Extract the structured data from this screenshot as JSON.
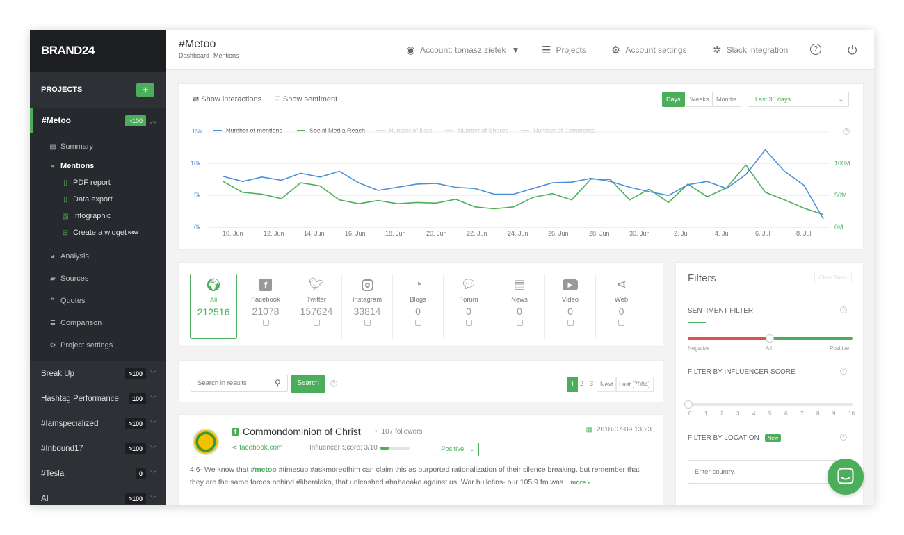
{
  "app": {
    "logo": "BRAND24"
  },
  "sidebar": {
    "projects_label": "PROJECTS",
    "add_label": "+",
    "active_project": {
      "name": "#Metoo",
      "badge": ">100"
    },
    "sub_items": [
      {
        "label": "Summary",
        "icon": "document-icon"
      },
      {
        "label": "Mentions",
        "icon": "chat-icon"
      },
      {
        "label": "PDF report",
        "icon": "pdf-icon"
      },
      {
        "label": "Data export",
        "icon": "export-icon"
      },
      {
        "label": "Infographic",
        "icon": "image-icon"
      },
      {
        "label": "Create a widget",
        "sup": "New",
        "icon": "widget-icon"
      },
      {
        "label": "Analysis",
        "icon": "pie-icon"
      },
      {
        "label": "Sources",
        "icon": "briefcase-icon"
      },
      {
        "label": "Quotes",
        "icon": "quote-icon"
      },
      {
        "label": "Comparison",
        "icon": "list-icon"
      },
      {
        "label": "Project settings",
        "icon": "cogs-icon"
      }
    ],
    "projects": [
      {
        "name": "Break Up",
        "badge": ">100"
      },
      {
        "name": "Hashtag Performance",
        "badge": "100"
      },
      {
        "name": "#Iamspecialized",
        "badge": ">100"
      },
      {
        "name": "#Inbound17",
        "badge": ">100"
      },
      {
        "name": "#Tesla",
        "badge": "0"
      },
      {
        "name": "AI",
        "badge": ">100"
      }
    ]
  },
  "header": {
    "title": "#Metoo",
    "breadcrumb": [
      "Dashboard",
      "Mentions"
    ],
    "account": "Account: tomasz.zietek",
    "projects": "Projects",
    "settings": "Account settings",
    "slack": "Slack integration",
    "help": "?",
    "power": "⏻"
  },
  "chart_card": {
    "show_interactions": "Show interactions",
    "show_sentiment": "Show sentiment",
    "granularity": [
      "Days",
      "Weeks",
      "Months"
    ],
    "range": "Last 30 days",
    "help": "?"
  },
  "chart_data": {
    "type": "line",
    "x": [
      "10. Jun",
      "12. Jun",
      "14. Jun",
      "16. Jun",
      "18. Jun",
      "20. Jun",
      "22. Jun",
      "24. Jun",
      "26. Jun",
      "28. Jun",
      "30. Jun",
      "2. Jul",
      "4. Jul",
      "6. Jul",
      "8. Jul"
    ],
    "left_ticks": [
      "15k",
      "10k",
      "5k",
      "0k"
    ],
    "right_ticks": [
      "100M",
      "50M",
      "0M"
    ],
    "ylim_left": [
      0,
      15000
    ],
    "ylim_right": [
      0,
      150000000
    ],
    "series": [
      {
        "name": "Number of mentions",
        "color": "#4a90d9",
        "axis": "left",
        "values": [
          8000,
          7200,
          7900,
          7400,
          8500,
          7900,
          8800,
          7000,
          5800,
          6300,
          6800,
          6900,
          6300,
          6100,
          5200,
          5200,
          6100,
          7000,
          7100,
          7700,
          7200,
          6300,
          5600,
          5000,
          6700,
          7200,
          6100,
          8300,
          12200,
          8800,
          6600,
          1300
        ]
      },
      {
        "name": "Social Media Reach",
        "color": "#4cae5b",
        "axis": "right",
        "values": [
          72000000,
          55000000,
          52000000,
          45000000,
          70000000,
          65000000,
          43000000,
          37000000,
          42000000,
          37000000,
          39000000,
          38000000,
          44000000,
          32000000,
          29000000,
          32000000,
          47000000,
          53000000,
          43000000,
          76000000,
          75000000,
          43000000,
          60000000,
          39000000,
          68000000,
          48000000,
          62000000,
          98000000,
          55000000,
          43000000,
          30000000,
          20000000
        ]
      },
      {
        "name": "Number of likes",
        "color": "#cccccc",
        "axis": "left",
        "values": []
      },
      {
        "name": "Number of Shares",
        "color": "#cccccc",
        "axis": "left",
        "values": []
      },
      {
        "name": "Number of Comments",
        "color": "#cccccc",
        "axis": "left",
        "values": []
      }
    ],
    "legend_position": "top-left"
  },
  "channels": [
    {
      "name": "All",
      "count": "212516",
      "icon": "globe-icon"
    },
    {
      "name": "Facebook",
      "count": "21078",
      "icon": "facebook-icon"
    },
    {
      "name": "Twitter",
      "count": "157624",
      "icon": "twitter-icon"
    },
    {
      "name": "Instagram",
      "count": "33814",
      "icon": "instagram-icon"
    },
    {
      "name": "Blogs",
      "count": "0",
      "icon": "rss-icon"
    },
    {
      "name": "Forum",
      "count": "0",
      "icon": "forum-icon"
    },
    {
      "name": "News",
      "count": "0",
      "icon": "news-icon"
    },
    {
      "name": "Video",
      "count": "0",
      "icon": "video-icon"
    },
    {
      "name": "Web",
      "count": "0",
      "icon": "share-icon"
    }
  ],
  "search": {
    "placeholder": "Search in results",
    "button": "Search",
    "help": "?",
    "pages": [
      "1",
      "2",
      "3"
    ],
    "next": "Next",
    "last": "Last [7084]"
  },
  "mention": {
    "author": "Commondominion of Christ",
    "followers": "107 followers",
    "date": "2018-07-09 13:23",
    "source": "facebook.com",
    "influencer": "Influencer Score: 3/10",
    "influencer_score": 0.3,
    "sentiment": "Positive",
    "text_before": "4:6- We know that ",
    "keyword": "#metoo",
    "text_after": " #timesup #askmoreofhim can claim this as purported rationalization of their silence breaking, but remember that they are the same forces behind #liberalako, that unleashed #babaeako against us. War bulletins- our 105.9 fm was",
    "more": "more »"
  },
  "filters": {
    "title": "Filters",
    "clear": "Clear filters",
    "sentiment_label": "SENTIMENT FILTER",
    "sentiment_ticks": [
      "Negative",
      "All",
      "Positive"
    ],
    "influencer_label": "FILTER BY INFLUENCER SCORE",
    "influencer_ticks": [
      "0",
      "1",
      "2",
      "3",
      "4",
      "5",
      "6",
      "7",
      "8",
      "9",
      "10"
    ],
    "location_label": "FILTER BY LOCATION",
    "location_badge": "New",
    "country_placeholder": "Enter country...",
    "help": "?"
  }
}
